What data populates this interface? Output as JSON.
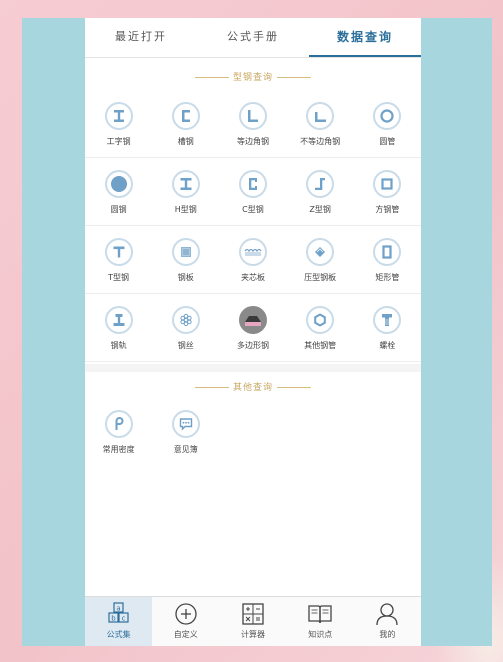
{
  "tabs": [
    "最近打开",
    "公式手册",
    "数据查询"
  ],
  "section1": "型钢查询",
  "section2": "其他查询",
  "grid": [
    [
      {
        "label": "工字钢",
        "icon": "i-beam-icon"
      },
      {
        "label": "槽钢",
        "icon": "channel-steel-icon"
      },
      {
        "label": "等边角钢",
        "icon": "equal-angle-icon"
      },
      {
        "label": "不等边角钢",
        "icon": "unequal-angle-icon"
      },
      {
        "label": "圆管",
        "icon": "round-pipe-icon"
      }
    ],
    [
      {
        "label": "圆钢",
        "icon": "round-bar-icon"
      },
      {
        "label": "H型钢",
        "icon": "h-beam-icon"
      },
      {
        "label": "C型钢",
        "icon": "c-steel-icon"
      },
      {
        "label": "Z型钢",
        "icon": "z-steel-icon"
      },
      {
        "label": "方钢管",
        "icon": "square-tube-icon"
      }
    ],
    [
      {
        "label": "T型钢",
        "icon": "t-steel-icon"
      },
      {
        "label": "钢板",
        "icon": "steel-plate-icon"
      },
      {
        "label": "夹芯板",
        "icon": "sandwich-panel-icon"
      },
      {
        "label": "压型钢板",
        "icon": "profiled-sheet-icon"
      },
      {
        "label": "矩形管",
        "icon": "rectangular-tube-icon"
      }
    ],
    [
      {
        "label": "钢轨",
        "icon": "rail-icon"
      },
      {
        "label": "钢丝",
        "icon": "steel-wire-icon"
      },
      {
        "label": "多边形钢",
        "icon": "polygon-steel-icon"
      },
      {
        "label": "其他钢管",
        "icon": "other-pipe-icon"
      },
      {
        "label": "螺栓",
        "icon": "bolt-icon"
      }
    ]
  ],
  "other": [
    {
      "label": "常用密度",
      "icon": "density-icon"
    },
    {
      "label": "意见簿",
      "icon": "feedback-icon"
    }
  ],
  "tabbar": [
    "公式集",
    "自定义",
    "计算器",
    "知识点",
    "我的"
  ],
  "colors": {
    "accent": "#2d6f9b",
    "gold": "#c9a760",
    "iconBlue": "#6fa0c8"
  }
}
